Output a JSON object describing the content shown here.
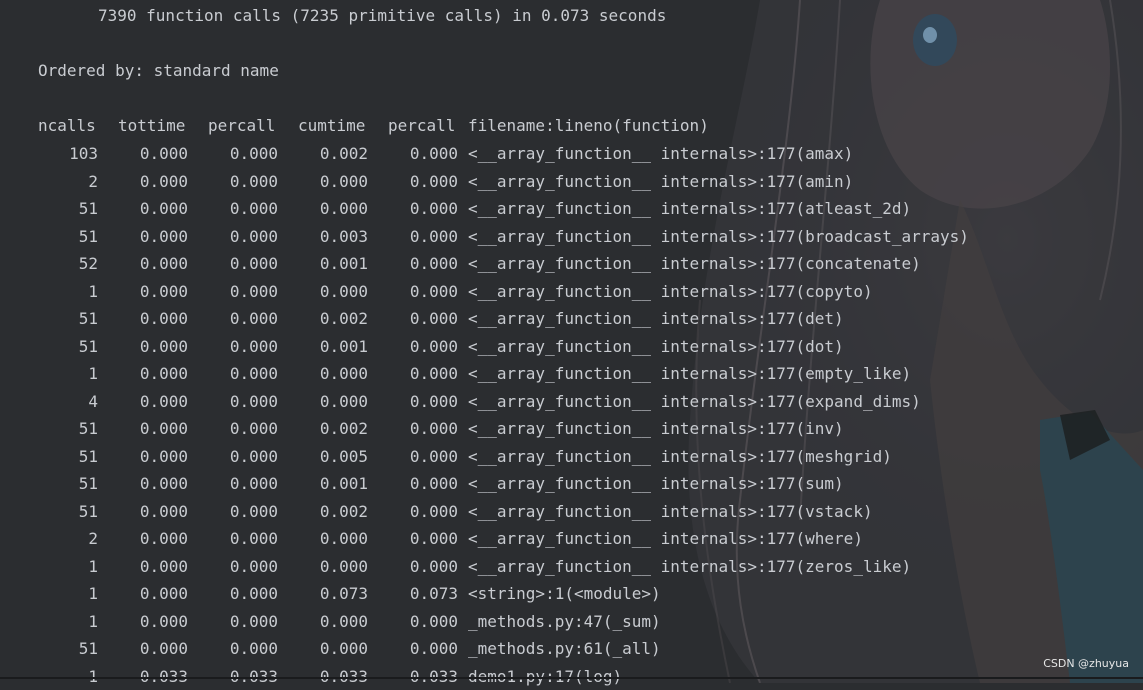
{
  "summary": "7390 function calls (7235 primitive calls) in 0.073 seconds",
  "ordered_by": "Ordered by: standard name",
  "columns": [
    "ncalls",
    "tottime",
    "percall",
    "cumtime",
    "percall",
    "filename:lineno(function)"
  ],
  "rows": [
    [
      "103",
      "0.000",
      "0.000",
      "0.002",
      "0.000",
      "<__array_function__ internals>:177(amax)"
    ],
    [
      "2",
      "0.000",
      "0.000",
      "0.000",
      "0.000",
      "<__array_function__ internals>:177(amin)"
    ],
    [
      "51",
      "0.000",
      "0.000",
      "0.000",
      "0.000",
      "<__array_function__ internals>:177(atleast_2d)"
    ],
    [
      "51",
      "0.000",
      "0.000",
      "0.003",
      "0.000",
      "<__array_function__ internals>:177(broadcast_arrays)"
    ],
    [
      "52",
      "0.000",
      "0.000",
      "0.001",
      "0.000",
      "<__array_function__ internals>:177(concatenate)"
    ],
    [
      "1",
      "0.000",
      "0.000",
      "0.000",
      "0.000",
      "<__array_function__ internals>:177(copyto)"
    ],
    [
      "51",
      "0.000",
      "0.000",
      "0.002",
      "0.000",
      "<__array_function__ internals>:177(det)"
    ],
    [
      "51",
      "0.000",
      "0.000",
      "0.001",
      "0.000",
      "<__array_function__ internals>:177(dot)"
    ],
    [
      "1",
      "0.000",
      "0.000",
      "0.000",
      "0.000",
      "<__array_function__ internals>:177(empty_like)"
    ],
    [
      "4",
      "0.000",
      "0.000",
      "0.000",
      "0.000",
      "<__array_function__ internals>:177(expand_dims)"
    ],
    [
      "51",
      "0.000",
      "0.000",
      "0.002",
      "0.000",
      "<__array_function__ internals>:177(inv)"
    ],
    [
      "51",
      "0.000",
      "0.000",
      "0.005",
      "0.000",
      "<__array_function__ internals>:177(meshgrid)"
    ],
    [
      "51",
      "0.000",
      "0.000",
      "0.001",
      "0.000",
      "<__array_function__ internals>:177(sum)"
    ],
    [
      "51",
      "0.000",
      "0.000",
      "0.002",
      "0.000",
      "<__array_function__ internals>:177(vstack)"
    ],
    [
      "2",
      "0.000",
      "0.000",
      "0.000",
      "0.000",
      "<__array_function__ internals>:177(where)"
    ],
    [
      "1",
      "0.000",
      "0.000",
      "0.000",
      "0.000",
      "<__array_function__ internals>:177(zeros_like)"
    ],
    [
      "1",
      "0.000",
      "0.000",
      "0.073",
      "0.073",
      "<string>:1(<module>)"
    ],
    [
      "1",
      "0.000",
      "0.000",
      "0.000",
      "0.000",
      "_methods.py:47(_sum)"
    ],
    [
      "51",
      "0.000",
      "0.000",
      "0.000",
      "0.000",
      "_methods.py:61(_all)"
    ],
    [
      "1",
      "0.033",
      "0.033",
      "0.033",
      "0.033",
      "demo1.py:17(log)"
    ]
  ],
  "watermark": "CSDN @zhuyua",
  "colors": {
    "background": "#2b2d30",
    "text": "#c9ccd1"
  }
}
